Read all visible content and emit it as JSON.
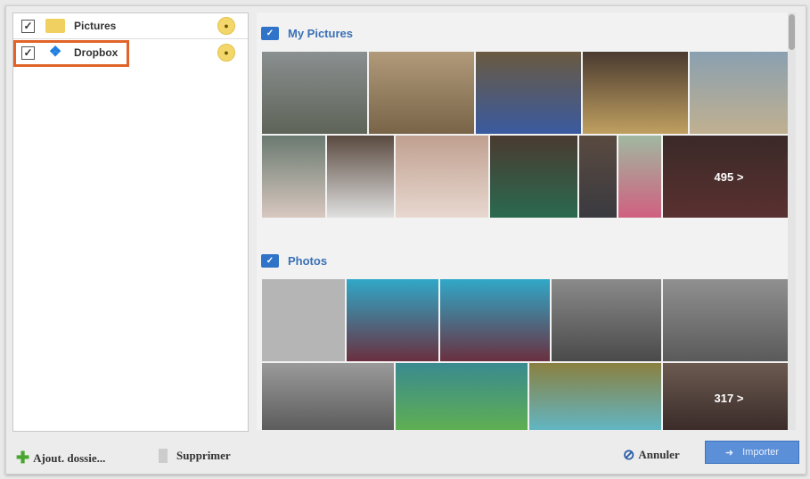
{
  "sources": [
    {
      "label": "Pictures",
      "checked": true
    },
    {
      "label": "Dropbox",
      "checked": true
    }
  ],
  "sections": [
    {
      "title": "My Pictures",
      "more": "495 >"
    },
    {
      "title": "Photos",
      "more": "317 >"
    }
  ],
  "footer": {
    "add_folder": "Ajout. dossie...",
    "delete": "Supprimer",
    "cancel": "Annuler",
    "import": "Importer"
  },
  "colors": {
    "accent": "#3a70b5",
    "highlight": "#e0632a",
    "import_button": "#5b8fd8"
  }
}
